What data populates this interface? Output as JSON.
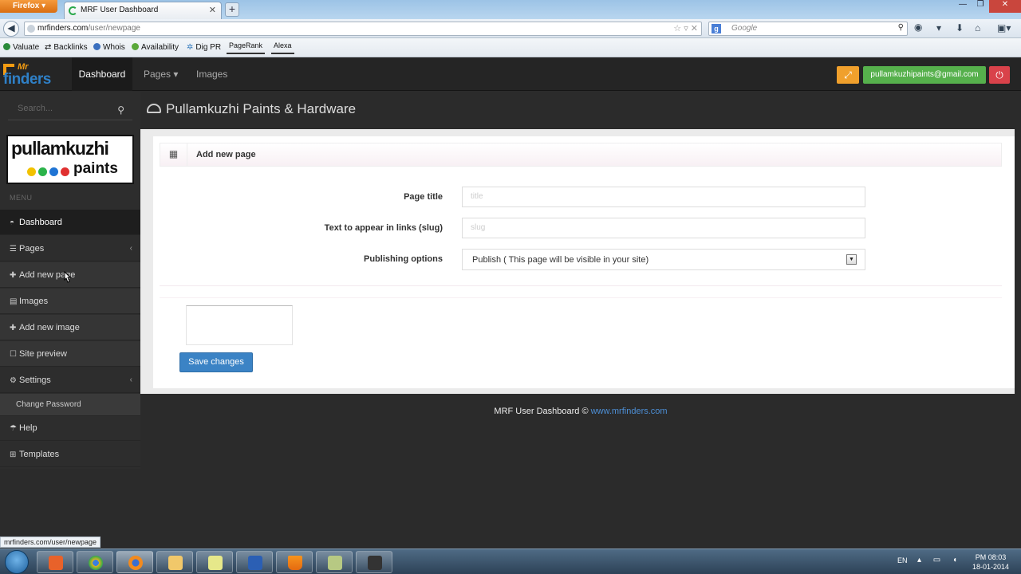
{
  "browser": {
    "menu_label": "Firefox",
    "tab_title": "MRF User Dashboard",
    "url_host": "mrfinders.com",
    "url_path": "/user/newpage",
    "search_placeholder": "Google",
    "bookmarks": [
      "Valuate",
      "Backlinks",
      "Whois",
      "Availability",
      "Dig PR",
      "PageRank",
      "Alexa"
    ],
    "status_url": "mrfinders.com/user/newpage"
  },
  "header": {
    "logo_top": "Mr",
    "logo_bottom": "finders",
    "nav": {
      "dashboard": "Dashboard",
      "pages": "Pages",
      "images": "Images"
    },
    "user_email": "pullamkuzhipaints@gmail.com",
    "colors": {
      "expand": "#f0a02c",
      "email": "#56b04c",
      "power": "#d9424a"
    }
  },
  "sidebar": {
    "search_placeholder": "Search...",
    "client_logo_top": "pullamkuzhi",
    "client_logo_bottom": "paints",
    "menu_label": "MENU",
    "items": {
      "dashboard": "Dashboard",
      "pages": "Pages",
      "add_new_page": "Add new page",
      "images": "Images",
      "add_new_image": "Add new image",
      "site_preview": "Site preview",
      "settings": "Settings",
      "change_password": "Change Password",
      "help": "Help",
      "templates": "Templates"
    }
  },
  "main": {
    "site_title": "Pullamkuzhi Paints & Hardware",
    "panel_title": "Add new page",
    "form": {
      "page_title_label": "Page title",
      "page_title_placeholder": "title",
      "slug_label": "Text to appear in links (slug)",
      "slug_placeholder": "slug",
      "publishing_label": "Publishing options",
      "publishing_value": "Publish ( This page will be visible in your site)"
    },
    "save_label": "Save changes",
    "footer_text": "MRF User Dashboard ©",
    "footer_link": "www.mrfinders.com"
  },
  "taskbar": {
    "lang": "EN",
    "time": "PM 08:03",
    "date": "18-01-2014"
  }
}
